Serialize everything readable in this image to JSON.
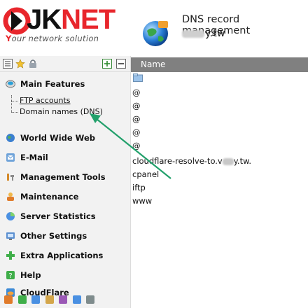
{
  "logo": {
    "brand_dark": "JK",
    "brand_red": "NET",
    "tagline_first": "Y",
    "tagline_rest": "our network solution"
  },
  "header": {
    "title": "DNS record management",
    "domain_suffix": "y.tw"
  },
  "sidebar": {
    "sections": [
      {
        "label": "Main Features",
        "icon": "globe-icon"
      },
      {
        "label": "World Wide Web",
        "icon": "web-icon"
      },
      {
        "label": "E-Mail",
        "icon": "mail-icon"
      },
      {
        "label": "Management Tools",
        "icon": "tools-icon"
      },
      {
        "label": "Maintenance",
        "icon": "maintenance-icon"
      },
      {
        "label": "Server Statistics",
        "icon": "stats-icon"
      },
      {
        "label": "Other Settings",
        "icon": "settings-icon"
      },
      {
        "label": "Extra Applications",
        "icon": "apps-icon"
      },
      {
        "label": "Help",
        "icon": "help-icon"
      },
      {
        "label": "CloudFlare",
        "icon": "cloudflare-icon"
      }
    ],
    "main_features_items": [
      {
        "label": "FTP accounts"
      },
      {
        "label": "Domain names (DNS)"
      }
    ]
  },
  "content": {
    "column_header": "Name",
    "rows": [
      "@",
      "@",
      "@",
      "@",
      "@",
      "cloudflare-resolve-to.v",
      "cpanel",
      "iftp",
      "www"
    ],
    "cloudflare_suffix": "y.tw."
  },
  "colors": {
    "brand_red": "#e8262c",
    "header_gray": "#808080",
    "arrow_green": "#22a06b"
  }
}
